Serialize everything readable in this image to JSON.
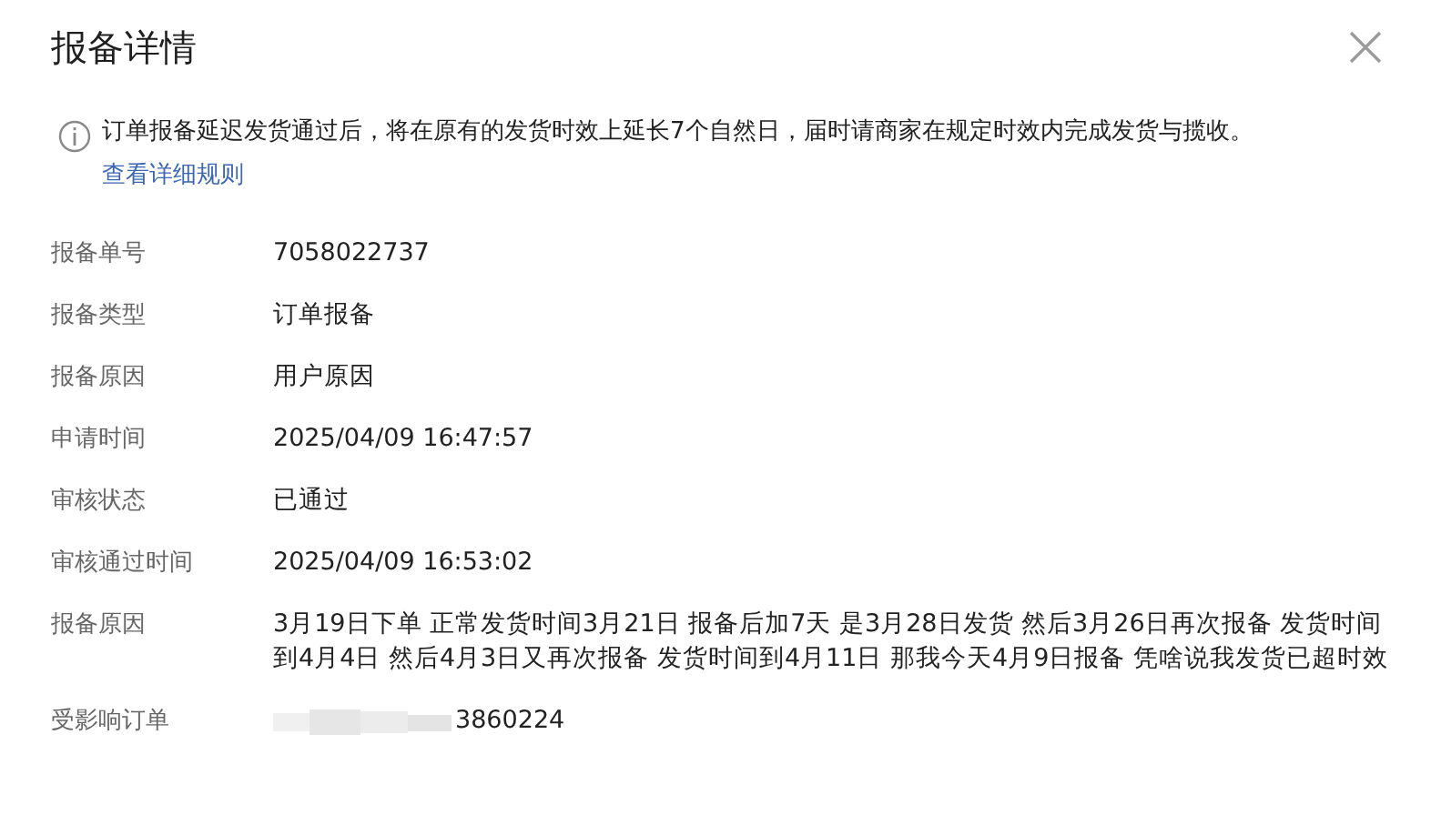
{
  "title": "报备详情",
  "notice": {
    "text": "订单报备延迟发货通过后，将在原有的发货时效上延长7个自然日，届时请商家在规定时效内完成发货与揽收。",
    "link": "查看详细规则"
  },
  "fields": [
    {
      "label": "报备单号",
      "value": "7058022737"
    },
    {
      "label": "报备类型",
      "value": "订单报备"
    },
    {
      "label": "报备原因",
      "value": "用户原因"
    },
    {
      "label": "申请时间",
      "value": "2025/04/09 16:47:57"
    },
    {
      "label": "审核状态",
      "value": "已通过"
    },
    {
      "label": "审核通过时间",
      "value": "2025/04/09 16:53:02"
    },
    {
      "label": "报备原因",
      "value": "3月19日下单 正常发货时间3月21日 报备后加7天 是3月28日发货 然后3月26日再次报备 发货时间到4月4日 然后4月3日又再次报备 发货时间到4月11日 那我今天4月9日报备 凭啥说我发货已超时效"
    },
    {
      "label": "受影响订单",
      "value": "3860224",
      "masked": true
    }
  ]
}
